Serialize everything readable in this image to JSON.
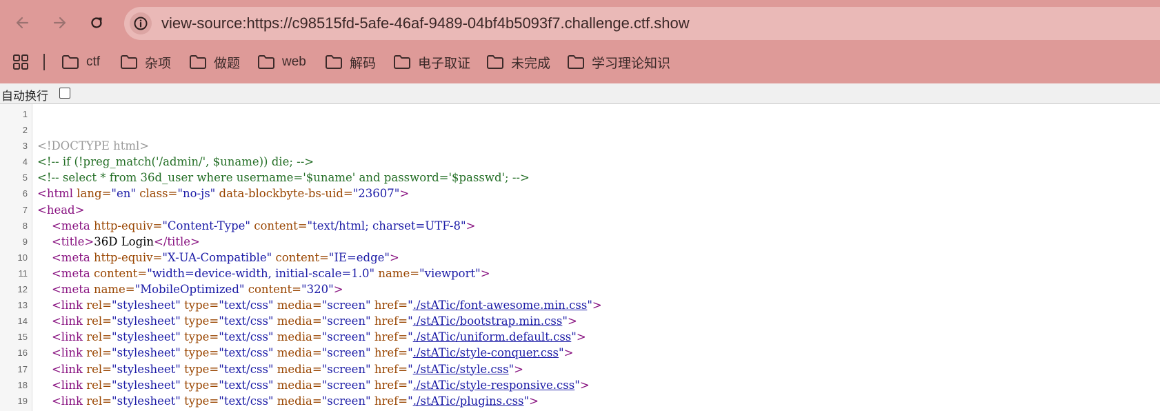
{
  "browser": {
    "url": "view-source:https://c98515fd-5afe-46af-9489-04bf4b5093f7.challenge.ctf.show"
  },
  "bookmarks": [
    {
      "label": "ctf"
    },
    {
      "label": "杂项"
    },
    {
      "label": "做题"
    },
    {
      "label": "web"
    },
    {
      "label": "解码"
    },
    {
      "label": "电子取证"
    },
    {
      "label": "未完成"
    },
    {
      "label": "学习理论知识"
    }
  ],
  "line_wrap": {
    "label": "自动换行",
    "checked": false
  },
  "source_lines": [
    {
      "num": "1",
      "tokens": []
    },
    {
      "num": "2",
      "tokens": []
    },
    {
      "num": "3",
      "tokens": [
        {
          "t": "<!DOCTYPE html>",
          "c": "doc"
        }
      ]
    },
    {
      "num": "4",
      "tokens": [
        {
          "t": "<!-- if (!preg_match('/admin/', $uname)) die; -->",
          "c": "comment"
        }
      ]
    },
    {
      "num": "5",
      "tokens": [
        {
          "t": "<!-- select * from 36d_user where username='$uname' and password='$passwd'; -->",
          "c": "comment"
        }
      ]
    },
    {
      "num": "6",
      "tokens": [
        {
          "t": "<html ",
          "c": "tag"
        },
        {
          "t": "lang=",
          "c": "attr"
        },
        {
          "t": "\"en\"",
          "c": "val"
        },
        {
          "t": " class=",
          "c": "attr"
        },
        {
          "t": "\"no-js\"",
          "c": "val"
        },
        {
          "t": " data-blockbyte-bs-uid=",
          "c": "attr"
        },
        {
          "t": "\"23607\"",
          "c": "val"
        },
        {
          "t": ">",
          "c": "tag"
        }
      ]
    },
    {
      "num": "7",
      "tokens": [
        {
          "t": "<head>",
          "c": "tag"
        }
      ]
    },
    {
      "num": "8",
      "tokens": [
        {
          "t": "    <meta ",
          "c": "tag"
        },
        {
          "t": "http-equiv=",
          "c": "attr"
        },
        {
          "t": "\"Content-Type\"",
          "c": "val"
        },
        {
          "t": " content=",
          "c": "attr"
        },
        {
          "t": "\"text/html; charset=UTF-8\"",
          "c": "val"
        },
        {
          "t": ">",
          "c": "tag"
        }
      ]
    },
    {
      "num": "9",
      "tokens": [
        {
          "t": "    <title>",
          "c": "tag"
        },
        {
          "t": "36D Login",
          "c": "text"
        },
        {
          "t": "</title>",
          "c": "tag"
        }
      ]
    },
    {
      "num": "10",
      "tokens": [
        {
          "t": "    <meta ",
          "c": "tag"
        },
        {
          "t": "http-equiv=",
          "c": "attr"
        },
        {
          "t": "\"X-UA-Compatible\"",
          "c": "val"
        },
        {
          "t": " content=",
          "c": "attr"
        },
        {
          "t": "\"IE=edge\"",
          "c": "val"
        },
        {
          "t": ">",
          "c": "tag"
        }
      ]
    },
    {
      "num": "11",
      "tokens": [
        {
          "t": "    <meta ",
          "c": "tag"
        },
        {
          "t": "content=",
          "c": "attr"
        },
        {
          "t": "\"width=device-width, initial-scale=1.0\"",
          "c": "val"
        },
        {
          "t": " name=",
          "c": "attr"
        },
        {
          "t": "\"viewport\"",
          "c": "val"
        },
        {
          "t": ">",
          "c": "tag"
        }
      ]
    },
    {
      "num": "12",
      "tokens": [
        {
          "t": "    <meta ",
          "c": "tag"
        },
        {
          "t": "name=",
          "c": "attr"
        },
        {
          "t": "\"MobileOptimized\"",
          "c": "val"
        },
        {
          "t": " content=",
          "c": "attr"
        },
        {
          "t": "\"320\"",
          "c": "val"
        },
        {
          "t": ">",
          "c": "tag"
        }
      ]
    },
    {
      "num": "13",
      "tokens": [
        {
          "t": "    <link ",
          "c": "tag"
        },
        {
          "t": "rel=",
          "c": "attr"
        },
        {
          "t": "\"stylesheet\"",
          "c": "val"
        },
        {
          "t": " type=",
          "c": "attr"
        },
        {
          "t": "\"text/css\"",
          "c": "val"
        },
        {
          "t": " media=",
          "c": "attr"
        },
        {
          "t": "\"screen\"",
          "c": "val"
        },
        {
          "t": " href=",
          "c": "attr"
        },
        {
          "t": "\"",
          "c": "val"
        },
        {
          "t": "./stATic/font-awesome.min.css",
          "c": "link"
        },
        {
          "t": "\"",
          "c": "val"
        },
        {
          "t": ">",
          "c": "tag"
        }
      ]
    },
    {
      "num": "14",
      "tokens": [
        {
          "t": "    <link ",
          "c": "tag"
        },
        {
          "t": "rel=",
          "c": "attr"
        },
        {
          "t": "\"stylesheet\"",
          "c": "val"
        },
        {
          "t": " type=",
          "c": "attr"
        },
        {
          "t": "\"text/css\"",
          "c": "val"
        },
        {
          "t": " media=",
          "c": "attr"
        },
        {
          "t": "\"screen\"",
          "c": "val"
        },
        {
          "t": " href=",
          "c": "attr"
        },
        {
          "t": "\"",
          "c": "val"
        },
        {
          "t": "./stATic/bootstrap.min.css",
          "c": "link"
        },
        {
          "t": "\"",
          "c": "val"
        },
        {
          "t": ">",
          "c": "tag"
        }
      ]
    },
    {
      "num": "15",
      "tokens": [
        {
          "t": "    <link ",
          "c": "tag"
        },
        {
          "t": "rel=",
          "c": "attr"
        },
        {
          "t": "\"stylesheet\"",
          "c": "val"
        },
        {
          "t": " type=",
          "c": "attr"
        },
        {
          "t": "\"text/css\"",
          "c": "val"
        },
        {
          "t": " media=",
          "c": "attr"
        },
        {
          "t": "\"screen\"",
          "c": "val"
        },
        {
          "t": " href=",
          "c": "attr"
        },
        {
          "t": "\"",
          "c": "val"
        },
        {
          "t": "./stATic/uniform.default.css",
          "c": "link"
        },
        {
          "t": "\"",
          "c": "val"
        },
        {
          "t": ">",
          "c": "tag"
        }
      ]
    },
    {
      "num": "16",
      "tokens": [
        {
          "t": "    <link ",
          "c": "tag"
        },
        {
          "t": "rel=",
          "c": "attr"
        },
        {
          "t": "\"stylesheet\"",
          "c": "val"
        },
        {
          "t": " type=",
          "c": "attr"
        },
        {
          "t": "\"text/css\"",
          "c": "val"
        },
        {
          "t": " media=",
          "c": "attr"
        },
        {
          "t": "\"screen\"",
          "c": "val"
        },
        {
          "t": " href=",
          "c": "attr"
        },
        {
          "t": "\"",
          "c": "val"
        },
        {
          "t": "./stATic/style-conquer.css",
          "c": "link"
        },
        {
          "t": "\"",
          "c": "val"
        },
        {
          "t": ">",
          "c": "tag"
        }
      ]
    },
    {
      "num": "17",
      "tokens": [
        {
          "t": "    <link ",
          "c": "tag"
        },
        {
          "t": "rel=",
          "c": "attr"
        },
        {
          "t": "\"stylesheet\"",
          "c": "val"
        },
        {
          "t": " type=",
          "c": "attr"
        },
        {
          "t": "\"text/css\"",
          "c": "val"
        },
        {
          "t": " media=",
          "c": "attr"
        },
        {
          "t": "\"screen\"",
          "c": "val"
        },
        {
          "t": " href=",
          "c": "attr"
        },
        {
          "t": "\"",
          "c": "val"
        },
        {
          "t": "./stATic/style.css",
          "c": "link"
        },
        {
          "t": "\"",
          "c": "val"
        },
        {
          "t": ">",
          "c": "tag"
        }
      ]
    },
    {
      "num": "18",
      "tokens": [
        {
          "t": "    <link ",
          "c": "tag"
        },
        {
          "t": "rel=",
          "c": "attr"
        },
        {
          "t": "\"stylesheet\"",
          "c": "val"
        },
        {
          "t": " type=",
          "c": "attr"
        },
        {
          "t": "\"text/css\"",
          "c": "val"
        },
        {
          "t": " media=",
          "c": "attr"
        },
        {
          "t": "\"screen\"",
          "c": "val"
        },
        {
          "t": " href=",
          "c": "attr"
        },
        {
          "t": "\"",
          "c": "val"
        },
        {
          "t": "./stATic/style-responsive.css",
          "c": "link"
        },
        {
          "t": "\"",
          "c": "val"
        },
        {
          "t": ">",
          "c": "tag"
        }
      ]
    },
    {
      "num": "19",
      "tokens": [
        {
          "t": "    <link ",
          "c": "tag"
        },
        {
          "t": "rel=",
          "c": "attr"
        },
        {
          "t": "\"stylesheet\"",
          "c": "val"
        },
        {
          "t": " type=",
          "c": "attr"
        },
        {
          "t": "\"text/css\"",
          "c": "val"
        },
        {
          "t": " media=",
          "c": "attr"
        },
        {
          "t": "\"screen\"",
          "c": "val"
        },
        {
          "t": " href=",
          "c": "attr"
        },
        {
          "t": "\"",
          "c": "val"
        },
        {
          "t": "./stATic/plugins.css",
          "c": "link"
        },
        {
          "t": "\"",
          "c": "val"
        },
        {
          "t": ">",
          "c": "tag"
        }
      ]
    }
  ]
}
